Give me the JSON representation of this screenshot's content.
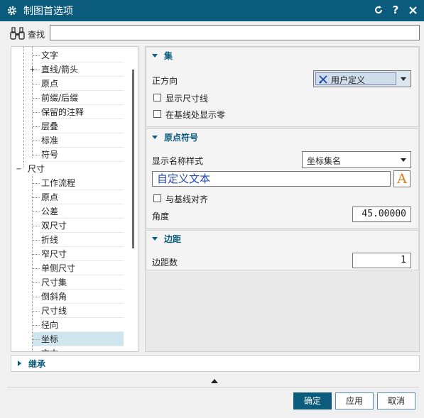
{
  "window": {
    "title": "制图首选项"
  },
  "find": {
    "label": "查找",
    "value": ""
  },
  "tree": {
    "items": [
      {
        "label": "文字",
        "level": 2
      },
      {
        "label": "直线/箭头",
        "level": 2,
        "expandable": true
      },
      {
        "label": "原点",
        "level": 2
      },
      {
        "label": "前缀/后缀",
        "level": 2
      },
      {
        "label": "保留的注释",
        "level": 2
      },
      {
        "label": "层叠",
        "level": 2
      },
      {
        "label": "标准",
        "level": 2
      },
      {
        "label": "符号",
        "level": 2
      },
      {
        "label": "尺寸",
        "level": 1,
        "expanded": true
      },
      {
        "label": "工作流程",
        "level": 2
      },
      {
        "label": "原点",
        "level": 2
      },
      {
        "label": "公差",
        "level": 2
      },
      {
        "label": "双尺寸",
        "level": 2
      },
      {
        "label": "折线",
        "level": 2
      },
      {
        "label": "窄尺寸",
        "level": 2
      },
      {
        "label": "单侧尺寸",
        "level": 2
      },
      {
        "label": "尺寸集",
        "level": 2
      },
      {
        "label": "倒斜角",
        "level": 2
      },
      {
        "label": "尺寸线",
        "level": 2
      },
      {
        "label": "径向",
        "level": 2
      },
      {
        "label": "坐标",
        "level": 2,
        "selected": true
      },
      {
        "label": "文本",
        "level": 2
      }
    ]
  },
  "set_group": {
    "title": "集",
    "direction_label": "正方向",
    "direction_value": "用户定义",
    "show_dim_line_label": "显示尺寸线",
    "show_zero_label": "在基线处显示零"
  },
  "origin_group": {
    "title": "原点符号",
    "name_style_label": "显示名称样式",
    "name_style_value": "坐标集名",
    "custom_text": "自定义文本",
    "font_button": "A",
    "align_label": "与基线对齐",
    "angle_label": "角度",
    "angle_value": "45.00000"
  },
  "margin_group": {
    "title": "边距",
    "count_label": "边距数",
    "count_value": "1"
  },
  "inherit": {
    "label": "继承"
  },
  "buttons": {
    "ok": "确定",
    "apply": "应用",
    "cancel": "取消"
  },
  "colors": {
    "accent": "#0b5b7c",
    "custom_text": "#2348b0",
    "font_icon": "#e07a1a",
    "selected_row": "#cfe6ee"
  }
}
